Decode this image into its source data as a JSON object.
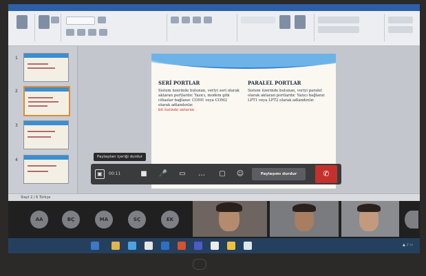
{
  "toolbar": {
    "tooltip": "Paylaşılan içeriği durdur",
    "timer": "00:11",
    "stop_sharing_label": "Paylaşımı durdur"
  },
  "slide": {
    "left_title": "SERİ PORTLAR",
    "left_body": "Sistem üzerinde bulunan, veriyi seri olarak aktaran portlardır. Yazıcı, modem gibi cihazlar bağlanır. COM1 veya COM2 olarak adlandırılır.",
    "left_red": "bit halinde aktarım",
    "right_title": "PARALEL PORTLAR",
    "right_body": "Sistem üzerinde bulunan, veriyi paralel olarak aktaran portlardır. Yazıcı bağlanır. LPT1 veya LPT2 olarak adlandırılır."
  },
  "statusbar": {
    "text": "Slayt 2 / 6   Türkçe"
  },
  "thumbnails": [
    {
      "num": "1"
    },
    {
      "num": "2"
    },
    {
      "num": "3"
    },
    {
      "num": "4"
    }
  ],
  "participants": {
    "avatars": [
      "AA",
      "BÇ",
      "MA",
      "SÇ",
      "EK"
    ],
    "videos": [
      {
        "name": ""
      },
      {
        "name": ""
      },
      {
        "name": ""
      }
    ]
  },
  "colors": {
    "ribbon_accent": "#2c5fa8",
    "toolbar_bg": "#3a3b3d",
    "hangup": "#c4312c",
    "taskbar": "#24405e"
  }
}
